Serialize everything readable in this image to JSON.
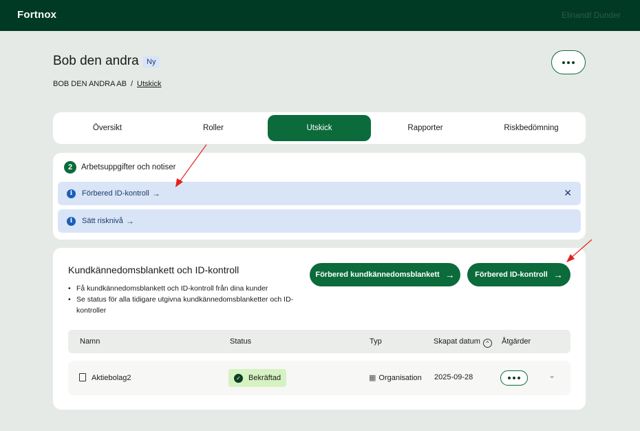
{
  "header": {
    "logo": "Fortnox",
    "user_name": "Elinandf Dunder"
  },
  "page": {
    "title": "Bob den andra",
    "badge": "Ny",
    "breadcrumb": {
      "company": "BOB DEN ANDRA AB",
      "separator": "/",
      "current": "Utskick"
    }
  },
  "tabs": [
    {
      "label": "Översikt",
      "active": false
    },
    {
      "label": "Roller",
      "active": false
    },
    {
      "label": "Utskick",
      "active": true
    },
    {
      "label": "Rapporter",
      "active": false
    },
    {
      "label": "Riskbedömning",
      "active": false
    }
  ],
  "notices": {
    "count": "2",
    "heading": "Arbetsuppgifter och notiser",
    "items": [
      {
        "label": "Förbered ID-kontroll",
        "dismissable": true
      },
      {
        "label": "Sätt risknivå",
        "dismissable": false
      }
    ]
  },
  "card": {
    "title": "Kundkännedomsblankett och ID-kontroll",
    "bullets": [
      "Få kundkännedomsblankett och ID-kontroll från dina kunder",
      "Se status för alla tidigare utgivna kundkännedomsblanketter och ID-kontroller"
    ],
    "buttons": {
      "prepare_form": "Förbered kundkännedomsblankett",
      "prepare_id": "Förbered ID-kontroll"
    }
  },
  "table": {
    "columns": [
      "Namn",
      "Status",
      "Typ",
      "Skapat datum",
      "Åtgärder"
    ],
    "rows": [
      {
        "name": "Aktiebolag2",
        "status": "Bekräftad",
        "type": "Organisation",
        "created": "2025-09-28"
      }
    ]
  },
  "colors": {
    "topbar": "#003a25",
    "primary": "#0b6b3a",
    "info_bg": "#d9e5f7",
    "success_bg": "#d6f2c2",
    "annotation": "#e5201c"
  },
  "icons": {
    "info": "info-icon",
    "close": "close-icon",
    "arrow": "arrow-right-icon",
    "check": "check-circle-icon",
    "document": "document-icon",
    "organisation": "building-icon",
    "sort": "sort-up-icon",
    "more": "more-dots-icon",
    "chevron": "chevron-down-icon"
  }
}
